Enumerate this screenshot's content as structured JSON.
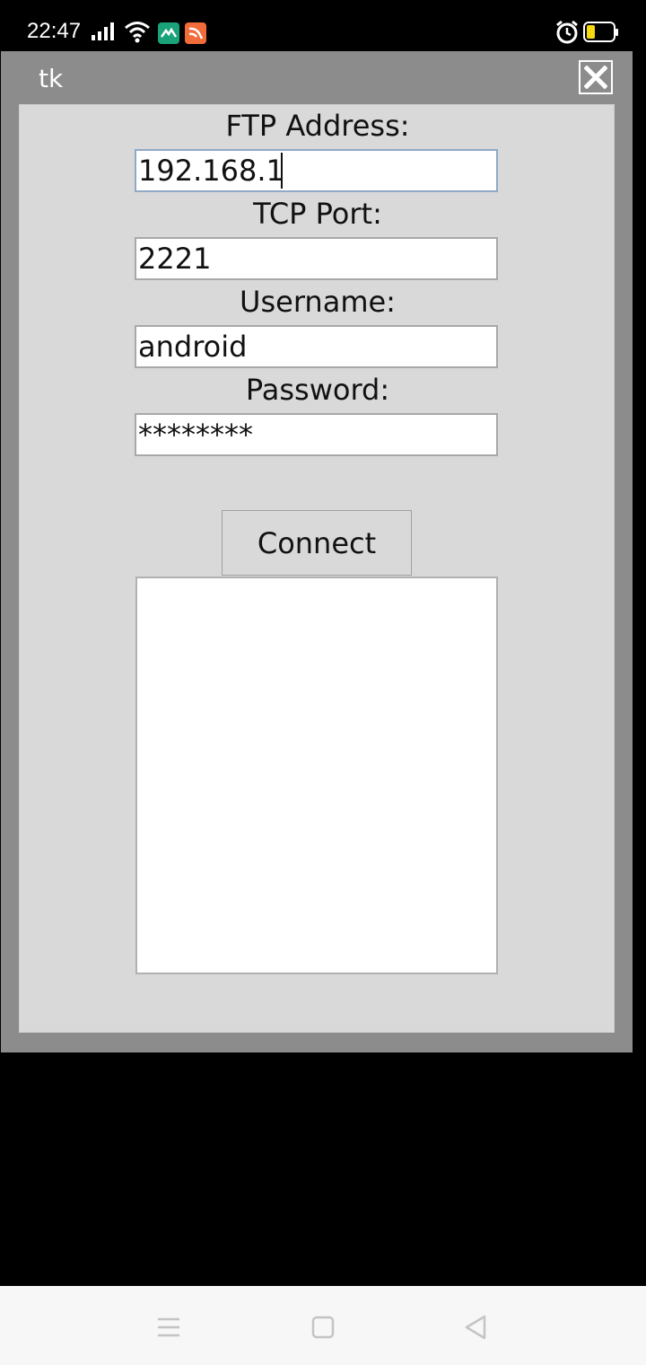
{
  "status_bar": {
    "time": "22:47",
    "icons": [
      "signal-icon",
      "wifi-icon",
      "app-notification-icon",
      "app-notification-icon",
      "alarm-icon",
      "battery-icon"
    ],
    "app_icon_colors": [
      "#1aa37a",
      "#f26b3a"
    ],
    "battery_color": "#f6d90f"
  },
  "window": {
    "title": "tk",
    "close_icon": "close-icon",
    "background_color": "#8c8c8c",
    "content_color": "#d9d9d9"
  },
  "form": {
    "ftp_address_label": "FTP Address:",
    "ftp_address_value": "192.168.1",
    "tcp_port_label": "TCP Port:",
    "tcp_port_value": "2221",
    "username_label": "Username:",
    "username_value": "android",
    "password_label": "Password:",
    "password_value": "********",
    "connect_label": "Connect",
    "output_text": ""
  },
  "nav_bar": {
    "buttons": [
      "menu-icon",
      "home-icon",
      "back-icon"
    ]
  }
}
